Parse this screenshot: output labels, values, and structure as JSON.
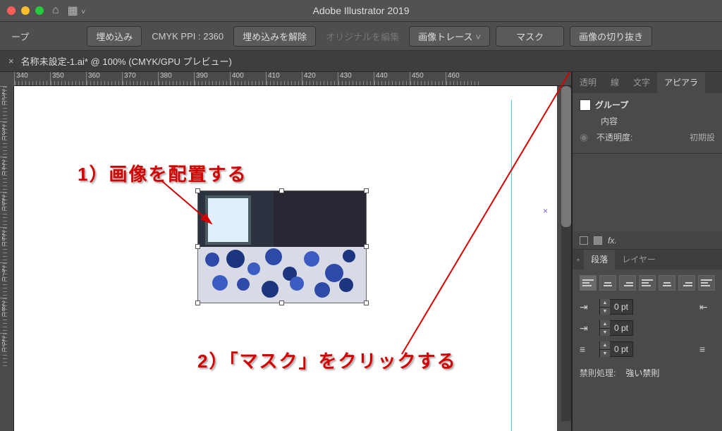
{
  "titlebar": {
    "title": "Adobe Illustrator 2019"
  },
  "controlbar": {
    "group_label": "ープ",
    "embed": "埋め込み",
    "color_info": "CMYK  PPI : 2360",
    "unembed": "埋め込みを解除",
    "edit_original": "オリジナルを編集",
    "image_trace": "画像トレース",
    "mask": "マスク",
    "crop": "画像の切り抜き"
  },
  "doc_tab": {
    "name": "名称未設定-1.ai* @ 100% (CMYK/GPU プレビュー)"
  },
  "ruler": {
    "h": [
      "340",
      "350",
      "360",
      "370",
      "380",
      "390",
      "400",
      "410",
      "420",
      "430",
      "440",
      "450",
      "460"
    ],
    "v": [
      "220",
      "230",
      "240",
      "250",
      "260",
      "270",
      "280",
      "290"
    ]
  },
  "annotations": {
    "a1": "1）画像を配置する",
    "a2": "2）「マスク」をクリックする"
  },
  "side": {
    "tabs_top": {
      "transparency": "透明",
      "stroke": "線",
      "character": "文字",
      "appearance": "アピアラ"
    },
    "group": {
      "label": "グループ",
      "contents": "内容",
      "opacity_label": "不透明度:",
      "opacity_default": "初期設"
    },
    "para_tabs": {
      "paragraph": "段落",
      "layers": "レイヤー"
    },
    "pt_values": {
      "v1": "0 pt",
      "v2": "0 pt",
      "v3": "0 pt"
    },
    "kinsoku": {
      "label": "禁則処理:",
      "value": "強い禁則"
    }
  }
}
